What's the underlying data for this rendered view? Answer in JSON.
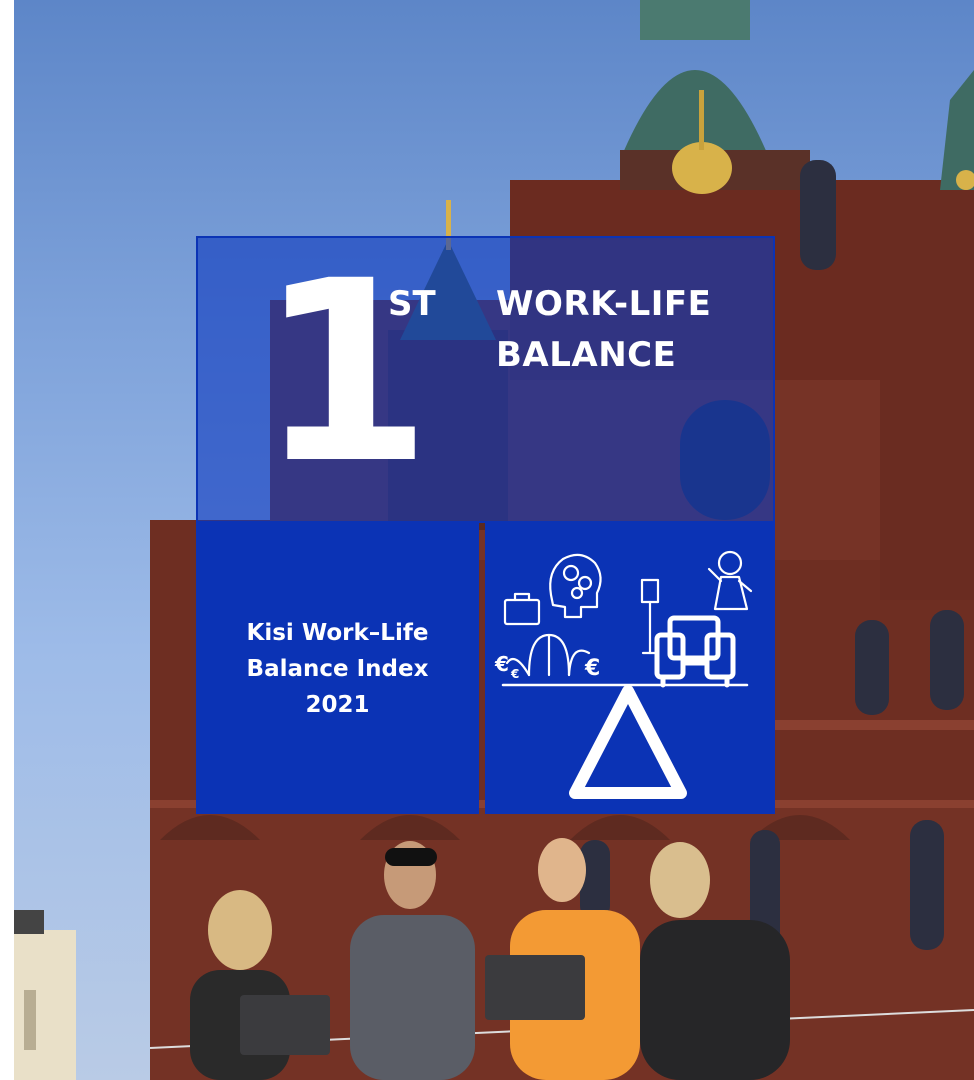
{
  "badge": {
    "rank_number": "1",
    "rank_suffix": "ST",
    "title_line1": "WORK-LIFE",
    "title_line2": "BALANCE"
  },
  "index": {
    "line1": "Kisi Work–Life",
    "line2": "Balance Index",
    "line3": "2021"
  },
  "icons": [
    "briefcase-icon",
    "head-gears-icon",
    "euro-fountain-icon",
    "floor-lamp-icon",
    "armchair-icon",
    "child-icon",
    "balance-scale-icon"
  ],
  "colors": {
    "brand_blue": "#0b33b5",
    "sky": "#7ea2da",
    "brick": "#7a3326",
    "copper_green": "#3f6b63",
    "gold": "#d8b24a"
  }
}
